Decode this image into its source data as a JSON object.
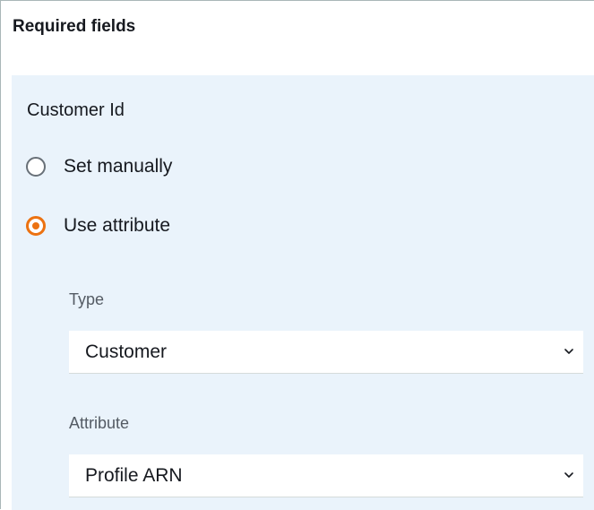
{
  "section": {
    "title": "Required fields"
  },
  "field": {
    "label": "Customer Id",
    "options": [
      {
        "label": "Set manually",
        "selected": false
      },
      {
        "label": "Use attribute",
        "selected": true
      }
    ]
  },
  "type_select": {
    "label": "Type",
    "value": "Customer"
  },
  "attribute_select": {
    "label": "Attribute",
    "value": "Profile ARN"
  },
  "colors": {
    "accent": "#ec7211",
    "panel_background": "#eaf3fb",
    "text": "#16191f",
    "muted_text": "#545b64"
  },
  "icons": {
    "select_chevron": "chevron-down-icon"
  }
}
